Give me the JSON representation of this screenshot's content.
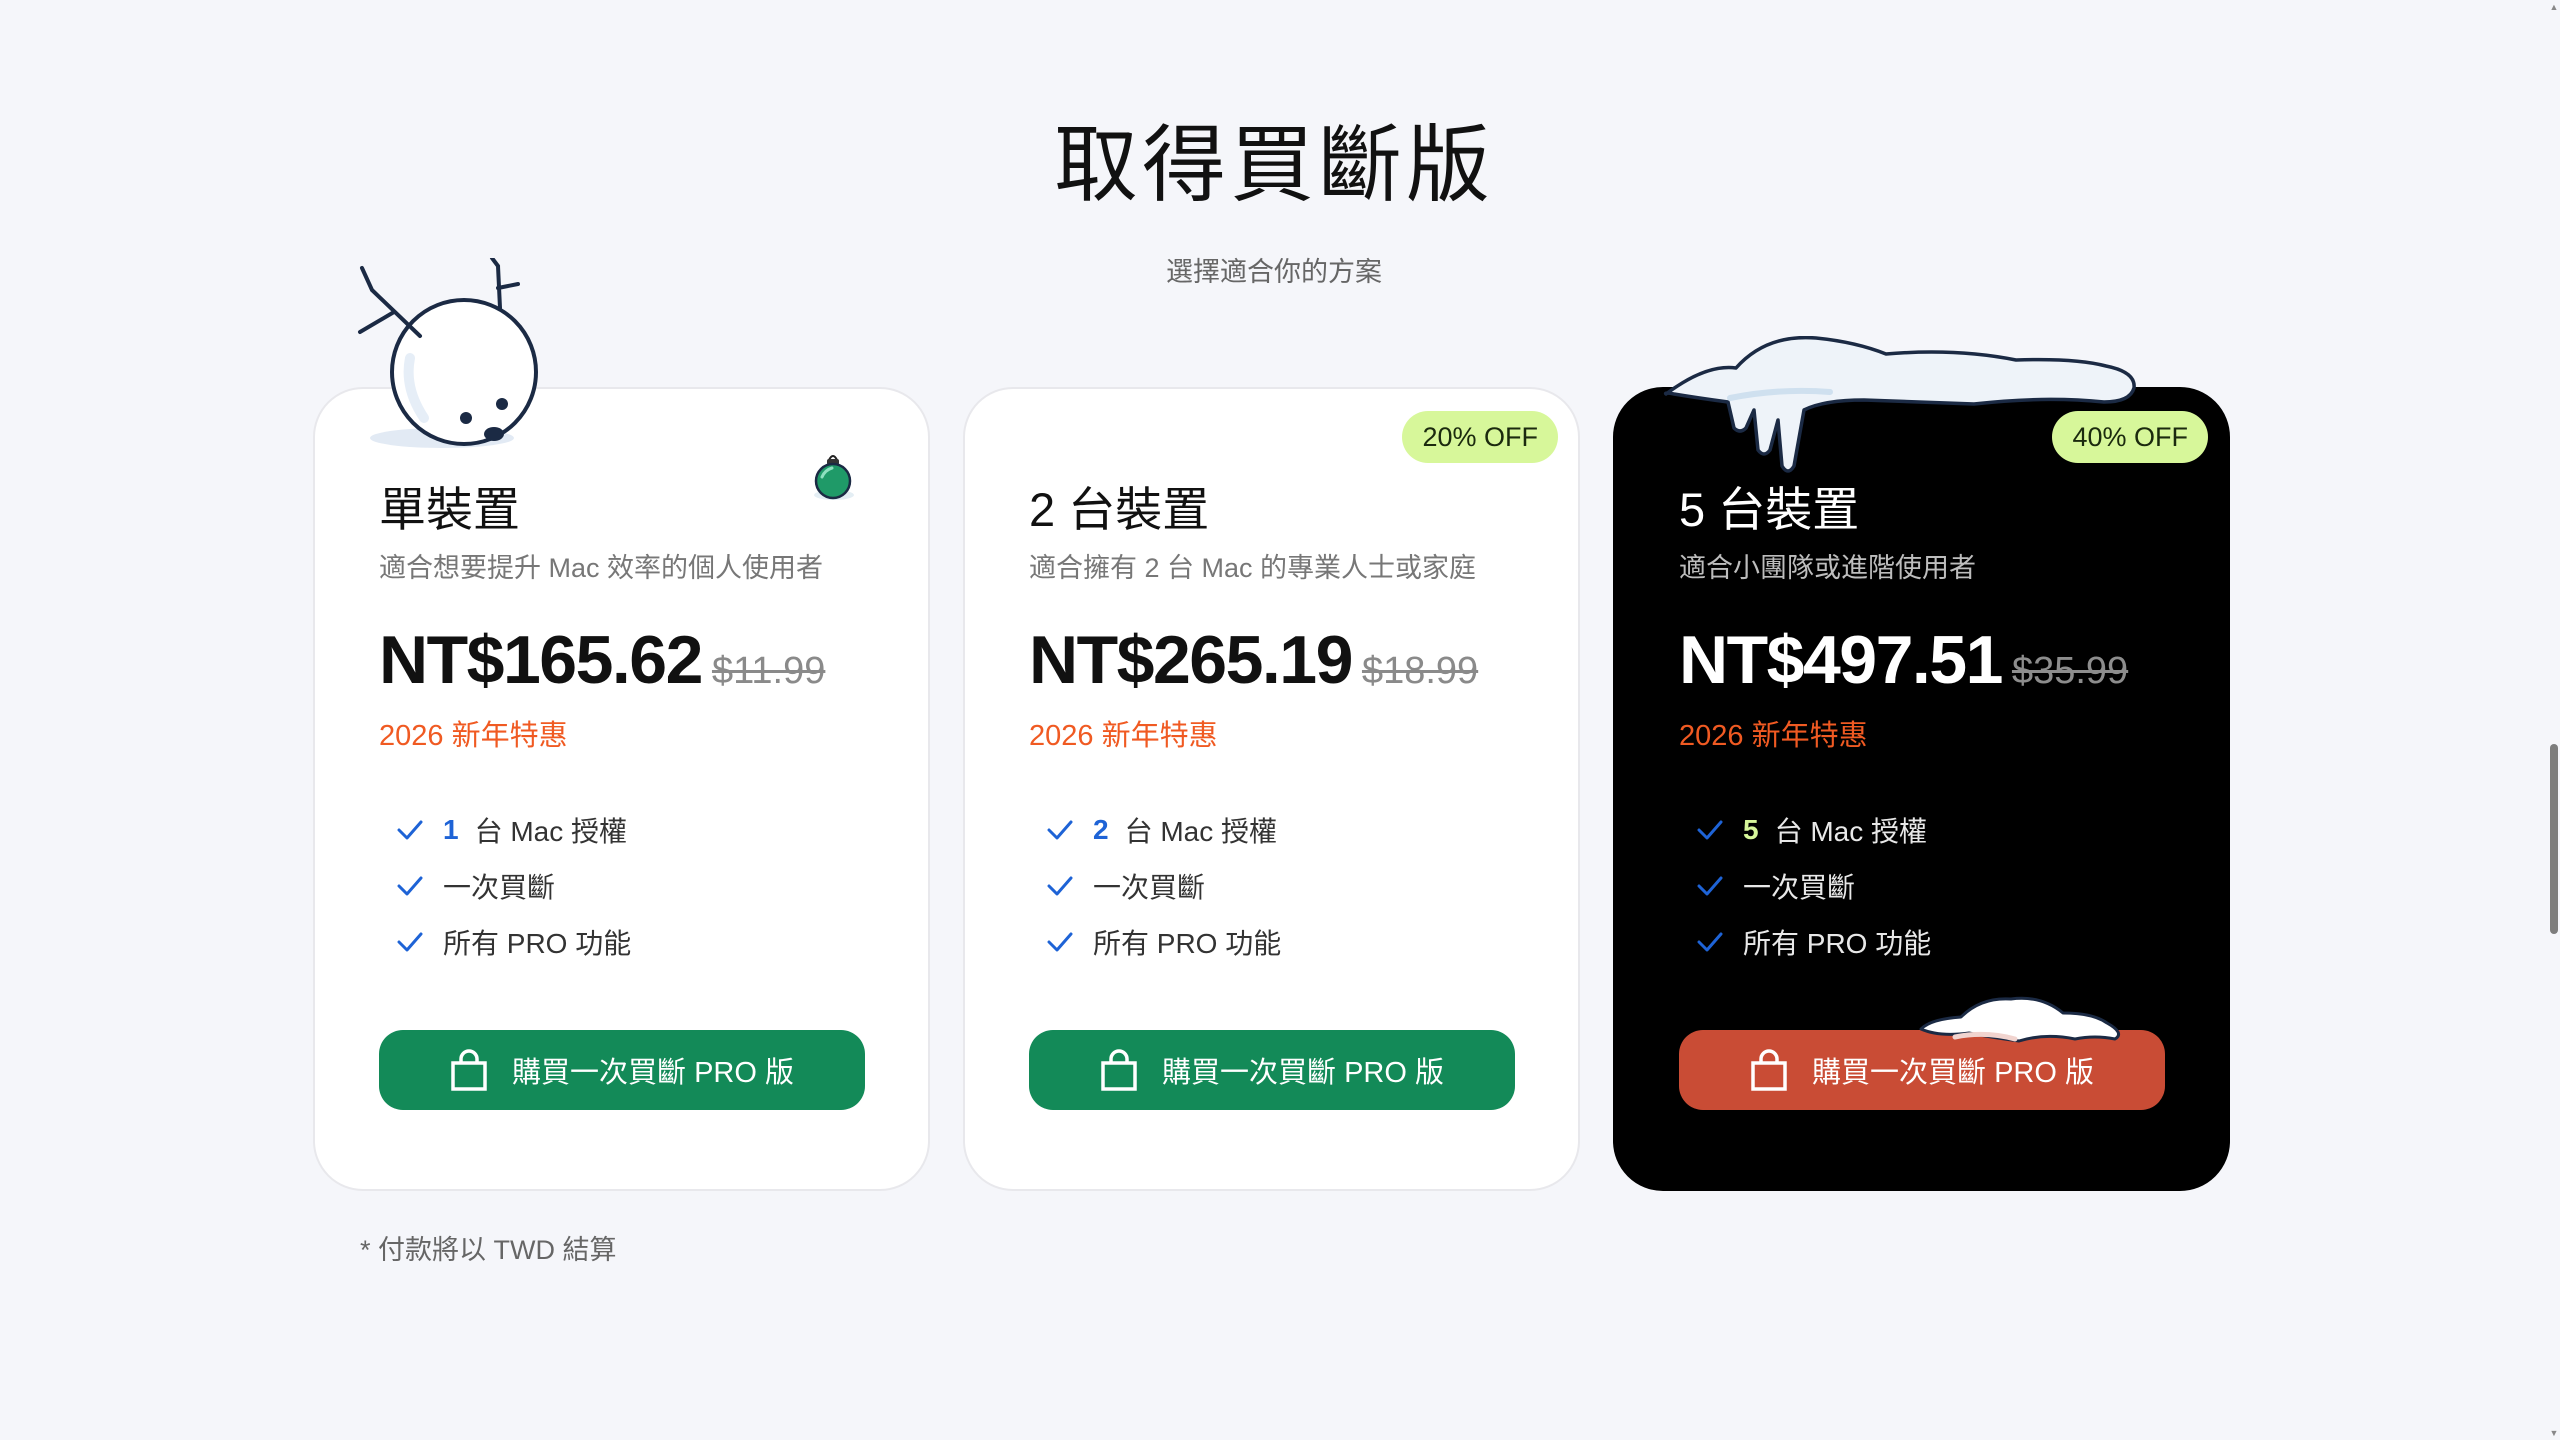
{
  "header": {
    "title": "取得買斷版",
    "subtitle": "選擇適合你的方案"
  },
  "plans": [
    {
      "name": "單裝置",
      "description": "適合想要提升 Mac 效率的個人使用者",
      "price": "NT$165.62",
      "old_price": "$11.99",
      "promo": "2026 新年特惠",
      "badge": "",
      "features": [
        {
          "num": "1",
          "text": "台 Mac 授權"
        },
        {
          "num": "",
          "text": "一次買斷"
        },
        {
          "num": "",
          "text": "所有 PRO 功能"
        }
      ],
      "button_label": "購買一次買斷 PRO 版"
    },
    {
      "name": "2 台裝置",
      "description": "適合擁有 2 台 Mac 的專業人士或家庭",
      "price": "NT$265.19",
      "old_price": "$18.99",
      "promo": "2026 新年特惠",
      "badge": "20% OFF",
      "features": [
        {
          "num": "2",
          "text": "台 Mac 授權"
        },
        {
          "num": "",
          "text": "一次買斷"
        },
        {
          "num": "",
          "text": "所有 PRO 功能"
        }
      ],
      "button_label": "購買一次買斷 PRO 版"
    },
    {
      "name": "5 台裝置",
      "description": "適合小團隊或進階使用者",
      "price": "NT$497.51",
      "old_price": "$35.99",
      "promo": "2026 新年特惠",
      "badge": "40% OFF",
      "features": [
        {
          "num": "5",
          "text": "台 Mac 授權"
        },
        {
          "num": "",
          "text": "一次買斷"
        },
        {
          "num": "",
          "text": "所有 PRO 功能"
        }
      ],
      "button_label": "購買一次買斷 PRO 版"
    }
  ],
  "footnote": "* 付款將以 TWD 結算",
  "colors": {
    "button_green": "#138a58",
    "button_red": "#c94c35",
    "badge": "#d7f79a",
    "promo": "#f05a22",
    "check": "#1e63d6"
  },
  "icons": {
    "check": "check-icon",
    "bag": "shopping-bag-icon",
    "snowman": "snowball-reindeer-decoration",
    "ornament": "christmas-ornament-icon",
    "snow": "snow-cap-decoration"
  }
}
